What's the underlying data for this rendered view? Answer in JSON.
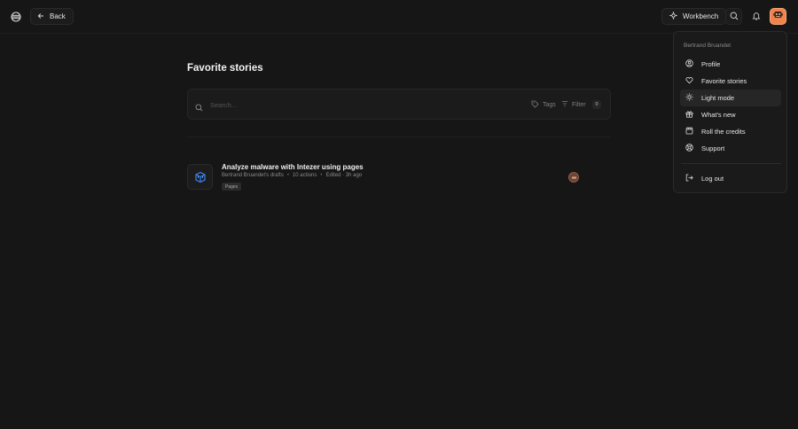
{
  "header": {
    "back_label": "Back",
    "workbench_label": "Workbench"
  },
  "page": {
    "title": "Favorite stories"
  },
  "search": {
    "placeholder": "Search...",
    "tags_label": "Tags",
    "filter_label": "Filter",
    "filter_count": "0"
  },
  "stories": [
    {
      "title": "Analyze malware with Intezer using pages",
      "source": "Bertrand Bruandet's drafts",
      "actions": "10 actions",
      "edited": "Edited · 3h ago",
      "tag": "Pages"
    }
  ],
  "user_menu": {
    "user_name": "Bertrand Bruandet",
    "items": [
      {
        "label": "Profile",
        "icon": "profile-icon"
      },
      {
        "label": "Favorite stories",
        "icon": "heart-icon"
      },
      {
        "label": "Light mode",
        "icon": "sun-icon"
      },
      {
        "label": "What's new",
        "icon": "gift-icon"
      },
      {
        "label": "Roll the credits",
        "icon": "clapperboard-icon"
      },
      {
        "label": "Support",
        "icon": "lifebuoy-icon"
      }
    ],
    "logout_label": "Log out",
    "active_item": "Light mode"
  },
  "colors": {
    "background": "#161616",
    "avatar_accent": "#f0824e",
    "story_icon_accent": "#3b82f6"
  }
}
